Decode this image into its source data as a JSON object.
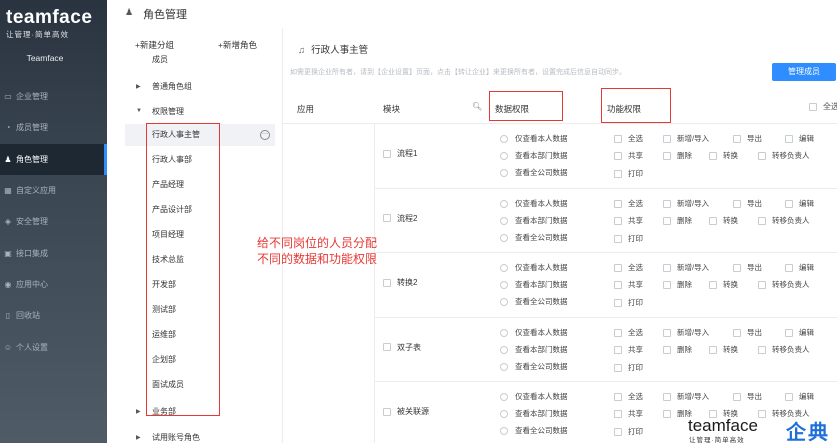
{
  "sidebar": {
    "logo": "teamface",
    "slogan": "让管理·简单高效",
    "tenant": "Teamface",
    "items": [
      {
        "label": "企业管理",
        "icon": "building-icon"
      },
      {
        "label": "成员管理",
        "icon": "members-icon"
      },
      {
        "label": "角色管理",
        "icon": "roles-icon"
      },
      {
        "label": "自定义应用",
        "icon": "custom-app-icon"
      },
      {
        "label": "安全管理",
        "icon": "shield-icon"
      },
      {
        "label": "接口集成",
        "icon": "api-icon"
      },
      {
        "label": "应用中心",
        "icon": "app-center-icon"
      },
      {
        "label": "回收站",
        "icon": "trash-icon"
      },
      {
        "label": "个人设置",
        "icon": "user-settings-icon"
      }
    ]
  },
  "header": {
    "title": "角色管理"
  },
  "tree": {
    "add_group": "+新建分组",
    "add_role": "+新增角色",
    "member_node": "成员",
    "group_normal": "普通角色组",
    "group_perm": "权限管理",
    "roles": [
      "行政人事主管",
      "行政人事部",
      "产品经理",
      "产品设计部",
      "项目经理",
      "技术总监",
      "开发部",
      "测试部",
      "运维部",
      "企划部",
      "面试成员"
    ],
    "group_business": "业务部",
    "group_trial": "试用账号角色"
  },
  "main": {
    "role_title": "行政人事主管",
    "notice": "如需更换企业所有者，请到【企业设置】页面，点击【转让企业】来更换所有者，设置完成后信息自动同步。",
    "manage_button": "管理成员",
    "columns": {
      "app": "应用",
      "module": "模块",
      "data": "数据权限",
      "func": "功能权限",
      "select_all": "全选"
    },
    "data_options": [
      "仅查看本人数据",
      "查看本部门数据",
      "查看全公司数据"
    ],
    "func_options": {
      "row1": [
        "全选",
        "新增/导入",
        "导出",
        "编辑"
      ],
      "row2": [
        "共享",
        "删除",
        "转换",
        "转移负责人"
      ],
      "row3": [
        "打印"
      ]
    },
    "modules": [
      "流程1",
      "流程2",
      "转换2",
      "双子表",
      "被关联源"
    ]
  },
  "annotation": {
    "line1": "给不同岗位的人员分配",
    "line2": "不同的数据和功能权限"
  },
  "watermark": {
    "brand": "teamface",
    "slogan": "让管理·简单高效",
    "cn": "企典"
  },
  "colors": {
    "accent": "#2f8dff",
    "annotation": "#e53935",
    "sidebar": "#2a3440"
  }
}
